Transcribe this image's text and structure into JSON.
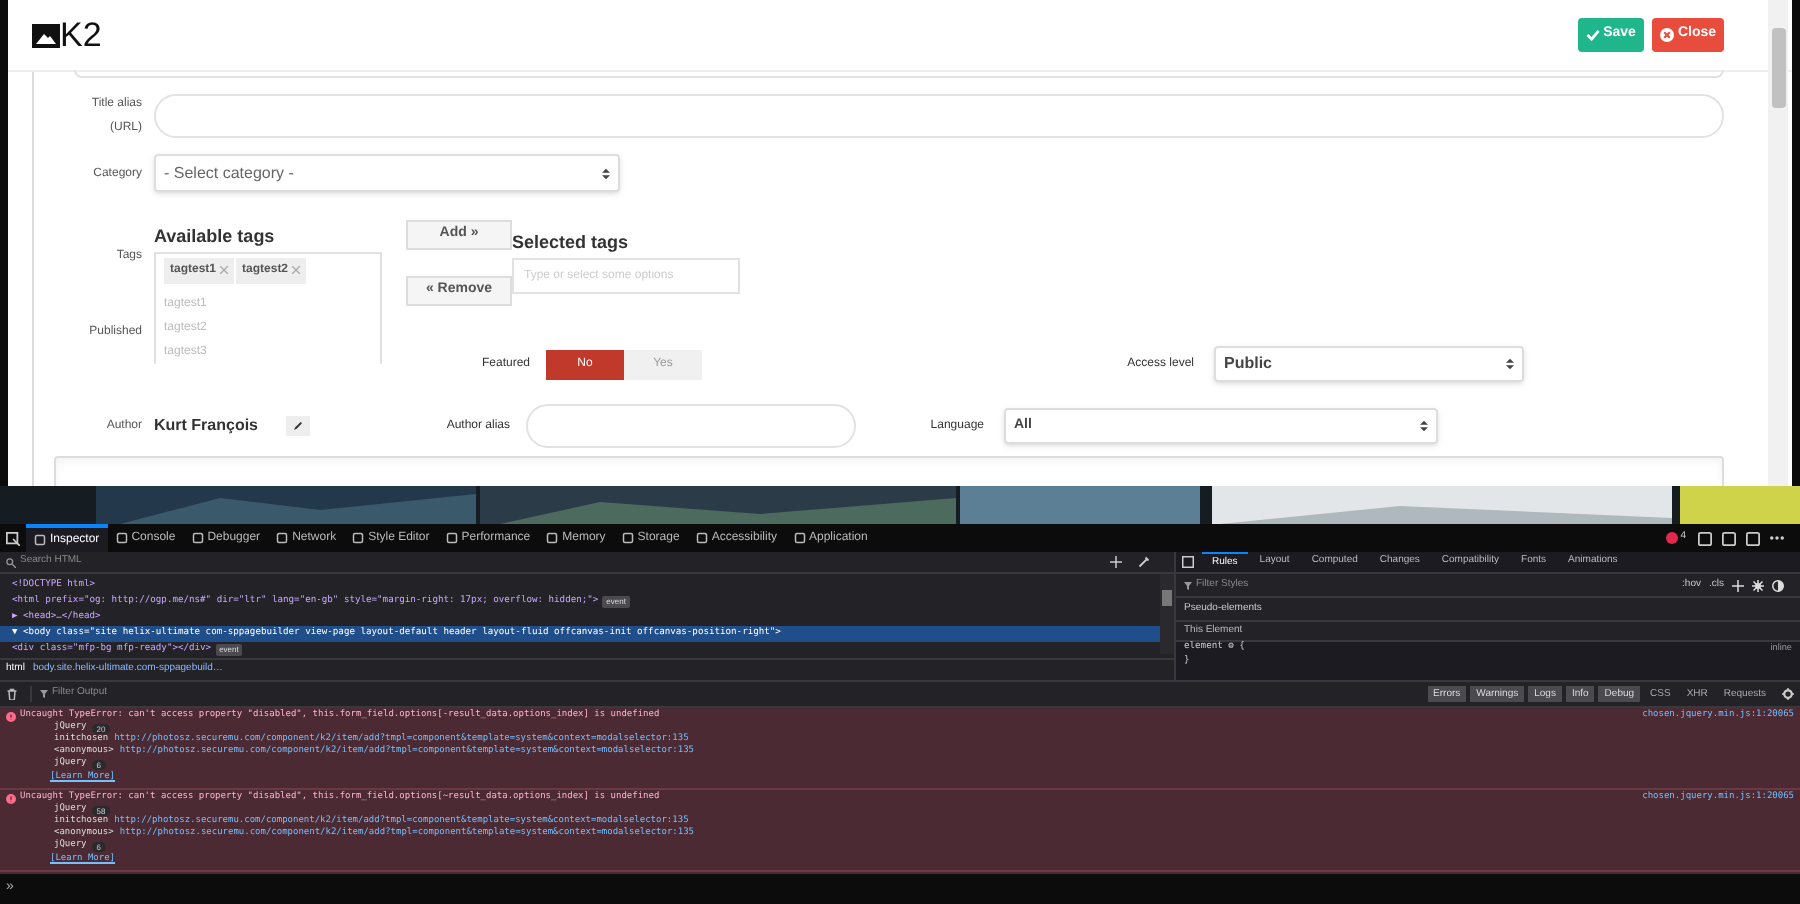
{
  "modal": {
    "logo": "K2",
    "buttons": [
      {
        "kind": "save",
        "label": "Save"
      },
      {
        "kind": "close",
        "label": "Close"
      }
    ],
    "form": {
      "title_alias": {
        "label": "Title alias",
        "sublabel": "(URL)"
      },
      "category": {
        "label": "Category",
        "value": "- Select category -"
      },
      "tags": {
        "label": "Tags",
        "available_heading": "Available tags",
        "chips": [
          "tagtest1",
          "tagtest2"
        ],
        "options": [
          "tagtest1",
          "tagtest2",
          "tagtest3"
        ],
        "add": "Add »",
        "remove": "« Remove",
        "selected_heading": "Selected tags",
        "placeholder": "Type or select some options"
      },
      "published": {
        "label": "Published"
      },
      "featured": {
        "label": "Featured",
        "options": [
          {
            "label": "No",
            "selected": true
          },
          {
            "label": "Yes",
            "selected": false
          }
        ]
      },
      "access_level": {
        "label": "Access level",
        "value": "Public"
      },
      "author": {
        "label": "Author",
        "value": "Kurt François"
      },
      "author_alias": {
        "label": "Author alias"
      },
      "language": {
        "label": "Language",
        "value": "All"
      }
    }
  },
  "devtools": {
    "tabs": [
      {
        "label": "Inspector",
        "selected": true
      },
      {
        "label": "Console",
        "selected": false
      },
      {
        "label": "Debugger",
        "selected": false
      },
      {
        "label": "Network",
        "selected": false
      },
      {
        "label": "Style Editor",
        "selected": false
      },
      {
        "label": "Performance",
        "selected": false
      },
      {
        "label": "Memory",
        "selected": false
      },
      {
        "label": "Storage",
        "selected": false
      },
      {
        "label": "Accessibility",
        "selected": false
      },
      {
        "label": "Application",
        "selected": false
      }
    ],
    "error_count": "4",
    "inspector": {
      "search_placeholder": "Search HTML",
      "lines": [
        {
          "text": "<!DOCTYPE html>",
          "selected": false
        },
        {
          "text": "<html prefix=\"og: http://ogp.me/ns#\" dir=\"ltr\" lang=\"en-gb\" style=\"margin-right: 17px; overflow: hidden;\">",
          "badge": "event",
          "selected": false
        },
        {
          "text": "▶ <head>…</head>",
          "selected": false
        },
        {
          "text": "▼ <body class=\"site helix-ultimate com-sppagebuilder view-page layout-default header layout-fluid offcanvas-init offcanvas-position-right\">",
          "selected": true
        },
        {
          "text": "<div class=\"mfp-bg mfp-ready\"></div>",
          "badge": "event",
          "selected": false
        }
      ],
      "breadcrumb": [
        "html",
        "body.site.helix-ultimate.com-sppagebuild…"
      ]
    },
    "rules": {
      "tabs": [
        {
          "label": "Rules",
          "selected": true
        },
        {
          "label": "Layout",
          "selected": false
        },
        {
          "label": "Computed",
          "selected": false
        },
        {
          "label": "Changes",
          "selected": false
        },
        {
          "label": "Compatibility",
          "selected": false
        },
        {
          "label": "Fonts",
          "selected": false
        },
        {
          "label": "Animations",
          "selected": false
        }
      ],
      "filter_placeholder": "Filter Styles",
      "hov": ":hov",
      "cls": ".cls",
      "pseudo": "Pseudo-elements",
      "this_element": "This Element",
      "rule_open": "element ⚙ {",
      "rule_close": "}",
      "source": "inline"
    },
    "console": {
      "filter_placeholder": "Filter Output",
      "levels": [
        {
          "label": "Errors",
          "selected": true
        },
        {
          "label": "Warnings",
          "selected": true
        },
        {
          "label": "Logs",
          "selected": true
        },
        {
          "label": "Info",
          "selected": true
        },
        {
          "label": "Debug",
          "selected": true
        },
        {
          "label": "CSS",
          "selected": false
        },
        {
          "label": "XHR",
          "selected": false
        },
        {
          "label": "Requests",
          "selected": false
        }
      ],
      "errors": [
        {
          "message": "Uncaught TypeError: can't access property \"disabled\", this.form_field.options[-result_data.options_index] is undefined",
          "source": "chosen.jquery.min.js:1:20065",
          "stack": [
            {
              "fn": "jQuery",
              "count": "20"
            },
            {
              "fn": "initchosen",
              "url": "http://photosz.securemu.com/component/k2/item/add?tmpl=component&template=system&context=modalselector:135"
            },
            {
              "fn": "<anonymous>",
              "url": "http://photosz.securemu.com/component/k2/item/add?tmpl=component&template=system&context=modalselector:135"
            },
            {
              "fn": "jQuery",
              "count": "6"
            }
          ],
          "learn_more": "[Learn More]"
        },
        {
          "message": "Uncaught TypeError: can't access property \"disabled\", this.form_field.options[~result_data.options_index] is undefined",
          "source": "chosen.jquery.min.js:1:20065",
          "stack": [
            {
              "fn": "jQuery",
              "count": "58"
            },
            {
              "fn": "initchosen",
              "url": "http://photosz.securemu.com/component/k2/item/add?tmpl=component&template=system&context=modalselector:135"
            },
            {
              "fn": "<anonymous>",
              "url": "http://photosz.securemu.com/component/k2/item/add?tmpl=component&template=system&context=modalselector:135"
            },
            {
              "fn": "jQuery",
              "count": "6"
            }
          ],
          "learn_more": "[Learn More]"
        }
      ],
      "prompt": "»"
    }
  }
}
